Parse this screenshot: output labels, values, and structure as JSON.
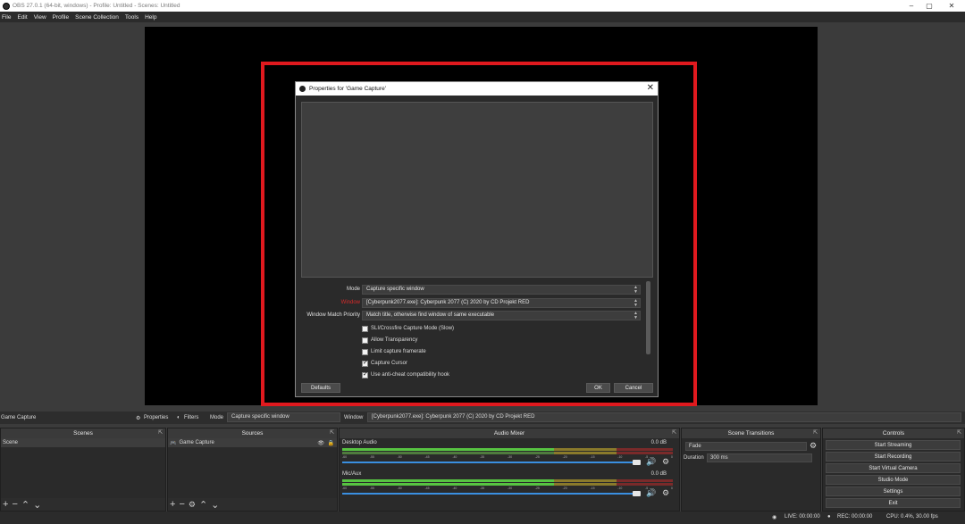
{
  "window": {
    "title": "OBS 27.0.1 (64-bit, windows) - Profile: Untitled - Scenes: Untitled",
    "controls": [
      "–",
      "▢",
      "✕"
    ]
  },
  "menu": [
    "File",
    "Edit",
    "View",
    "Profile",
    "Scene Collection",
    "Tools",
    "Help"
  ],
  "dialog": {
    "title": "Properties for 'Game Capture'",
    "close": "✕",
    "properties": {
      "mode_label": "Mode",
      "mode_value": "Capture specific window",
      "window_label": "Window",
      "window_value": "[Cyberpunk2077.exe]: Cyberpunk 2077 (C) 2020 by CD Projekt RED",
      "priority_label": "Window Match Priority",
      "priority_value": "Match title, otherwise find window of same executable"
    },
    "checkboxes": [
      {
        "label": "SLI/Crossfire Capture Mode (Slow)",
        "checked": false
      },
      {
        "label": "Allow Transparency",
        "checked": false
      },
      {
        "label": "Limit capture framerate",
        "checked": false
      },
      {
        "label": "Capture Cursor",
        "checked": true
      },
      {
        "label": "Use anti-cheat compatibility hook",
        "checked": true
      }
    ],
    "defaults_button": "Defaults",
    "ok_button": "OK",
    "cancel_button": "Cancel"
  },
  "source_toolbar": {
    "source_name": "Game Capture",
    "properties": "Properties",
    "filters": "Filters",
    "mode_label": "Mode",
    "mode_value": "Capture specific window",
    "window_label": "Window",
    "window_value": "[Cyberpunk2077.exe]: Cyberpunk 2077 (C) 2020 by CD Projekt RED"
  },
  "scenes": {
    "header": "Scenes",
    "items": [
      "Scene"
    ]
  },
  "sources": {
    "header": "Sources",
    "items": [
      "Game Capture"
    ]
  },
  "mixer": {
    "header": "Audio Mixer",
    "channels": [
      {
        "name": "Desktop Audio",
        "db": "0.0 dB"
      },
      {
        "name": "Mic/Aux",
        "db": "0.0 dB"
      }
    ],
    "ticks": [
      "-60",
      "-55",
      "-50",
      "-45",
      "-40",
      "-35",
      "-30",
      "-25",
      "-20",
      "-15",
      "-10",
      "-5",
      "0"
    ]
  },
  "transitions": {
    "header": "Scene Transitions",
    "transition": "Fade",
    "duration_label": "Duration",
    "duration_value": "300 ms"
  },
  "controls": {
    "header": "Controls",
    "buttons": [
      "Start Streaming",
      "Start Recording",
      "Start Virtual Camera",
      "Studio Mode",
      "Settings",
      "Exit"
    ]
  },
  "status": {
    "live": "LIVE: 00:00:00",
    "rec": "REC: 00:00:00",
    "cpu": "CPU: 0.4%, 30.00 fps"
  },
  "colors": {
    "highlight": "#e0191e",
    "volume_slider": "#3a8fe0"
  }
}
